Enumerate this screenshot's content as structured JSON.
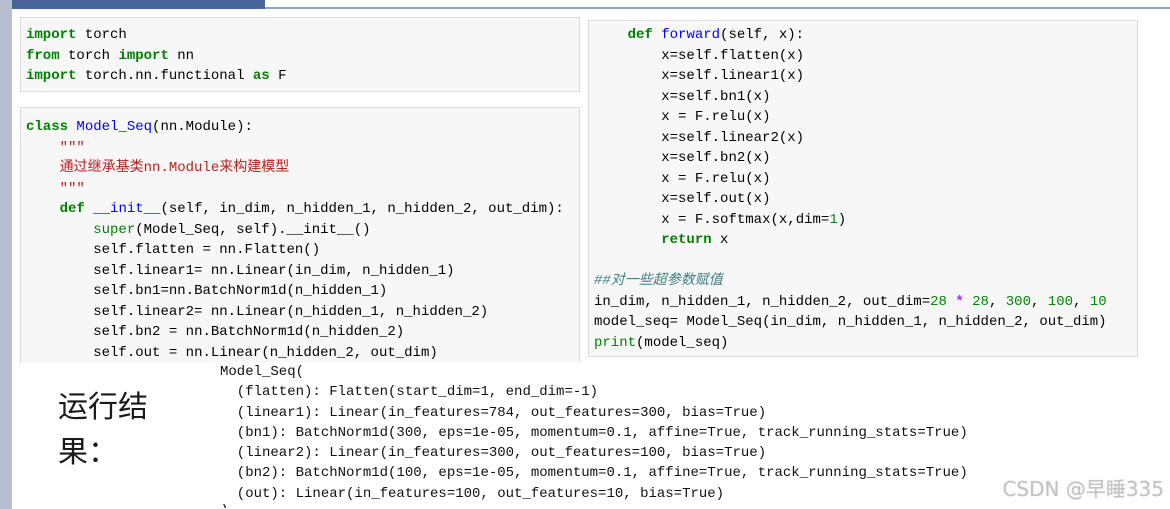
{
  "theme": {
    "left_bar": "#b6bfcf",
    "header_bar": "#47659a",
    "header_rule": "#8ea4c8",
    "keyword": "#008000",
    "builtin": "#008000",
    "def_name": "#0000ff",
    "string": "#ba2121",
    "comment": "#408080",
    "number": "#008800",
    "operator": "#aa22ff",
    "watermark": "#c3c3c3"
  },
  "cells": {
    "imports": [
      "import torch",
      "from torch import nn",
      "import torch.nn.functional as F"
    ],
    "model_class": [
      "class Model_Seq(nn.Module):",
      "    \"\"\"",
      "    通过继承基类nn.Module来构建模型",
      "    \"\"\"",
      "    def __init__(self, in_dim, n_hidden_1, n_hidden_2, out_dim):",
      "        super(Model_Seq, self).__init__()",
      "        self.flatten = nn.Flatten()",
      "        self.linear1= nn.Linear(in_dim, n_hidden_1)",
      "        self.bn1=nn.BatchNorm1d(n_hidden_1)",
      "        self.linear2= nn.Linear(n_hidden_1, n_hidden_2)",
      "        self.bn2 = nn.BatchNorm1d(n_hidden_2)",
      "        self.out = nn.Linear(n_hidden_2, out_dim)"
    ],
    "forward_and_setup": [
      "    def forward(self, x):",
      "        x=self.flatten(x)",
      "        x=self.linear1(x)",
      "        x=self.bn1(x)",
      "        x = F.relu(x)",
      "        x=self.linear2(x)",
      "        x=self.bn2(x)",
      "        x = F.relu(x)",
      "        x=self.out(x)",
      "        x = F.softmax(x,dim=1)",
      "        return x",
      "",
      "##对一些超参数赋值",
      "in_dim, n_hidden_1, n_hidden_2, out_dim=28 * 28, 300, 100, 10",
      "model_seq= Model_Seq(in_dim, n_hidden_1, n_hidden_2, out_dim)",
      "print(model_seq)"
    ]
  },
  "result_label": "运行结果：",
  "output": [
    "Model_Seq(",
    "  (flatten): Flatten(start_dim=1, end_dim=-1)",
    "  (linear1): Linear(in_features=784, out_features=300, bias=True)",
    "  (bn1): BatchNorm1d(300, eps=1e-05, momentum=0.1, affine=True, track_running_stats=True)",
    "  (linear2): Linear(in_features=300, out_features=100, bias=True)",
    "  (bn2): BatchNorm1d(100, eps=1e-05, momentum=0.1, affine=True, track_running_stats=True)",
    "  (out): Linear(in_features=100, out_features=10, bias=True)",
    ")"
  ],
  "watermark": "CSDN @早睡335"
}
